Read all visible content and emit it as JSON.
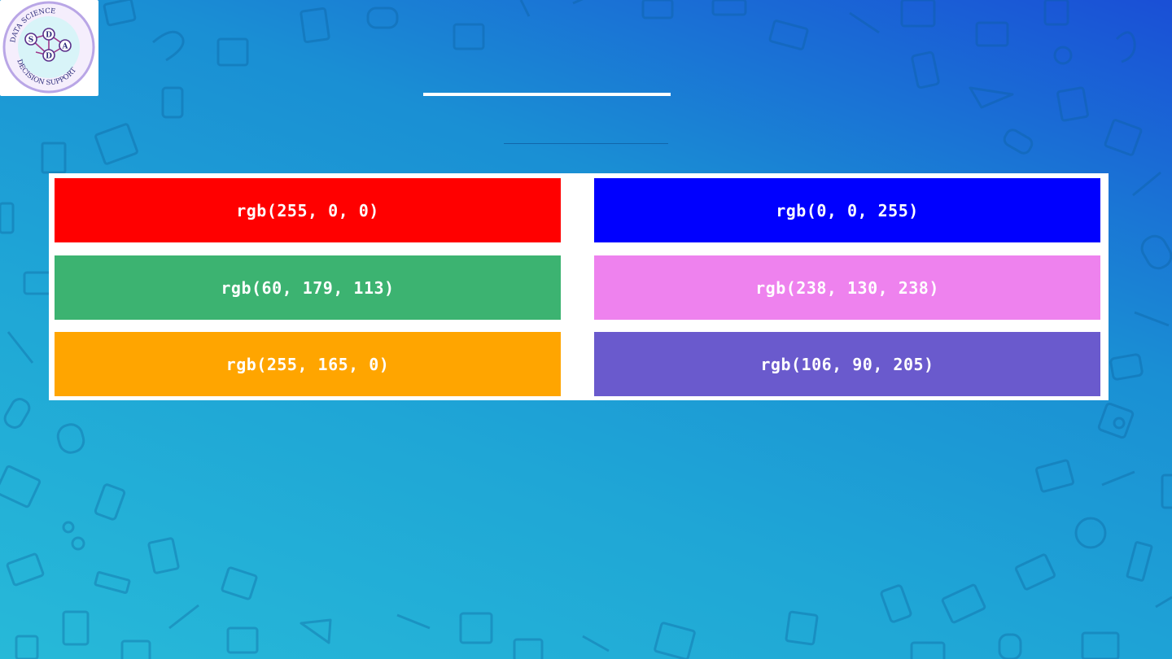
{
  "logo": {
    "ring_text": "DATA SCIENCE · DECISION SUPPORT",
    "letters": [
      "S",
      "D",
      "A",
      "D"
    ]
  },
  "swatches": [
    {
      "label": "rgb(255, 0, 0)",
      "color": "#ff0000"
    },
    {
      "label": "rgb(0, 0, 255)",
      "color": "#0000ff"
    },
    {
      "label": "rgb(60, 179, 113)",
      "color": "#3cb371"
    },
    {
      "label": "rgb(238, 130, 238)",
      "color": "#ee82ee"
    },
    {
      "label": "rgb(255, 165, 0)",
      "color": "#ffa500"
    },
    {
      "label": "rgb(106, 90, 205)",
      "color": "#6a5acd"
    }
  ]
}
